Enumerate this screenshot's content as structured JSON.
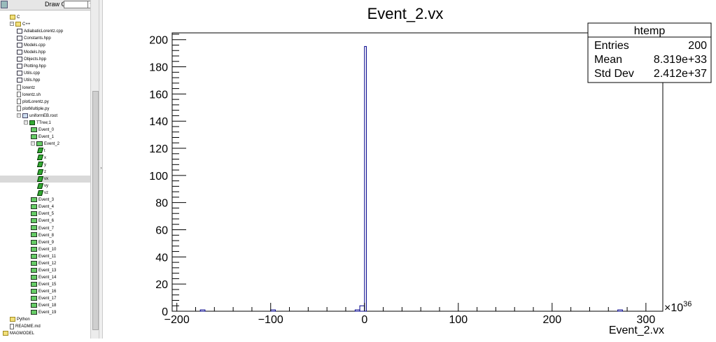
{
  "toolbar": {
    "draw_option_label": "Draw Option:",
    "draw_option_value": ""
  },
  "tree": [
    {
      "label": "C",
      "depth": 1,
      "icon": "folder",
      "exp": ""
    },
    {
      "label": "C++",
      "depth": 1,
      "icon": "folder",
      "exp": "−"
    },
    {
      "label": "AdiabaticLorentz.cpp",
      "depth": 2,
      "icon": "file-c"
    },
    {
      "label": "Constants.hpp",
      "depth": 2,
      "icon": "file-h"
    },
    {
      "label": "Models.cpp",
      "depth": 2,
      "icon": "file-c"
    },
    {
      "label": "Models.hpp",
      "depth": 2,
      "icon": "file-h"
    },
    {
      "label": "Objects.hpp",
      "depth": 2,
      "icon": "file-h"
    },
    {
      "label": "Plotting.hpp",
      "depth": 2,
      "icon": "file-h"
    },
    {
      "label": "Utils.cpp",
      "depth": 2,
      "icon": "file-c"
    },
    {
      "label": "Utils.hpp",
      "depth": 2,
      "icon": "file-h"
    },
    {
      "label": "lorentz",
      "depth": 2,
      "icon": "file-plain"
    },
    {
      "label": "lorentz.sh",
      "depth": 2,
      "icon": "file-plain"
    },
    {
      "label": "plotLorentz.py",
      "depth": 2,
      "icon": "file-plain"
    },
    {
      "label": "plotMultiple.py",
      "depth": 2,
      "icon": "file-plain"
    },
    {
      "label": "uniformEB.root",
      "depth": 2,
      "icon": "root-file",
      "exp": "−"
    },
    {
      "label": "TTree;1",
      "depth": 3,
      "icon": "tree",
      "exp": "−"
    },
    {
      "label": "Event_0",
      "depth": 4,
      "icon": "branch"
    },
    {
      "label": "Event_1",
      "depth": 4,
      "icon": "branch"
    },
    {
      "label": "Event_2",
      "depth": 4,
      "icon": "branch",
      "exp": "−"
    },
    {
      "label": "t",
      "depth": 5,
      "icon": "leaf"
    },
    {
      "label": "x",
      "depth": 5,
      "icon": "leaf"
    },
    {
      "label": "y",
      "depth": 5,
      "icon": "leaf"
    },
    {
      "label": "z",
      "depth": 5,
      "icon": "leaf"
    },
    {
      "label": "vx",
      "depth": 5,
      "icon": "leaf",
      "selected": true
    },
    {
      "label": "vy",
      "depth": 5,
      "icon": "leaf"
    },
    {
      "label": "vz",
      "depth": 5,
      "icon": "leaf"
    },
    {
      "label": "Event_3",
      "depth": 4,
      "icon": "branch"
    },
    {
      "label": "Event_4",
      "depth": 4,
      "icon": "branch"
    },
    {
      "label": "Event_5",
      "depth": 4,
      "icon": "branch"
    },
    {
      "label": "Event_6",
      "depth": 4,
      "icon": "branch"
    },
    {
      "label": "Event_7",
      "depth": 4,
      "icon": "branch"
    },
    {
      "label": "Event_8",
      "depth": 4,
      "icon": "branch"
    },
    {
      "label": "Event_9",
      "depth": 4,
      "icon": "branch"
    },
    {
      "label": "Event_10",
      "depth": 4,
      "icon": "branch"
    },
    {
      "label": "Event_11",
      "depth": 4,
      "icon": "branch"
    },
    {
      "label": "Event_12",
      "depth": 4,
      "icon": "branch"
    },
    {
      "label": "Event_13",
      "depth": 4,
      "icon": "branch"
    },
    {
      "label": "Event_14",
      "depth": 4,
      "icon": "branch"
    },
    {
      "label": "Event_15",
      "depth": 4,
      "icon": "branch"
    },
    {
      "label": "Event_16",
      "depth": 4,
      "icon": "branch"
    },
    {
      "label": "Event_17",
      "depth": 4,
      "icon": "branch"
    },
    {
      "label": "Event_18",
      "depth": 4,
      "icon": "branch"
    },
    {
      "label": "Event_19",
      "depth": 4,
      "icon": "branch"
    },
    {
      "label": "Python",
      "depth": 1,
      "icon": "folder"
    },
    {
      "label": "README.md",
      "depth": 1,
      "icon": "file-plain"
    },
    {
      "label": "MAGMODEL",
      "depth": 0,
      "icon": "folder"
    }
  ],
  "stats": {
    "name": "htemp",
    "rows": [
      {
        "label": "Entries",
        "value": "200"
      },
      {
        "label": "Mean",
        "value": "8.319e+33"
      },
      {
        "label": "Std Dev",
        "value": "2.412e+37"
      }
    ]
  },
  "chart_data": {
    "type": "bar",
    "title": "Event_2.vx",
    "xlabel": "Event_2.vx",
    "x_multiplier": "×10",
    "x_multiplier_exp": "36",
    "xlim": [
      -205,
      318
    ],
    "ylim": [
      0,
      205
    ],
    "x_ticks": [
      -200,
      -100,
      0,
      100,
      200,
      300
    ],
    "x_tick_labels": [
      "−200",
      "−100",
      "0",
      "100",
      "200",
      "300"
    ],
    "y_ticks": [
      0,
      20,
      40,
      60,
      80,
      100,
      120,
      140,
      160,
      180,
      200
    ],
    "bins": [
      {
        "x0": -175,
        "x1": -170,
        "value": 1
      },
      {
        "x0": -100,
        "x1": -95,
        "value": 1
      },
      {
        "x0": -10,
        "x1": -5,
        "value": 1
      },
      {
        "x0": -5,
        "x1": 0,
        "value": 4
      },
      {
        "x0": 0,
        "x1": 2,
        "value": 195
      },
      {
        "x0": 270,
        "x1": 275,
        "value": 1
      }
    ],
    "line_color": "#00008b",
    "grid": false
  }
}
